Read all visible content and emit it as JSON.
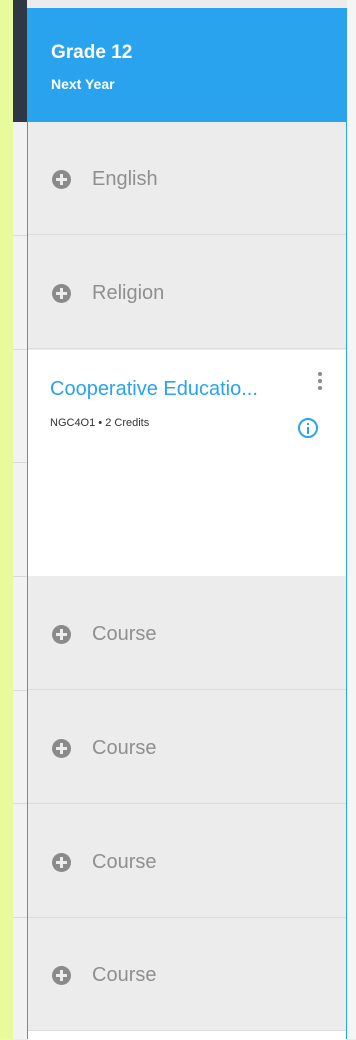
{
  "header": {
    "grade": "Grade 12",
    "period": "Next Year"
  },
  "slots_top": [
    {
      "label": "English"
    },
    {
      "label": "Religion"
    }
  ],
  "card": {
    "name": "Cooperative Educatio...",
    "meta": "NGC4O1 • 2 Credits"
  },
  "slots_bottom": [
    {
      "label": "Course"
    },
    {
      "label": "Course"
    },
    {
      "label": "Course"
    },
    {
      "label": "Course"
    }
  ],
  "colors": {
    "accent": "#2aa3ee",
    "slot_bg": "#ececec",
    "left_strip": "#e7fb9d"
  }
}
